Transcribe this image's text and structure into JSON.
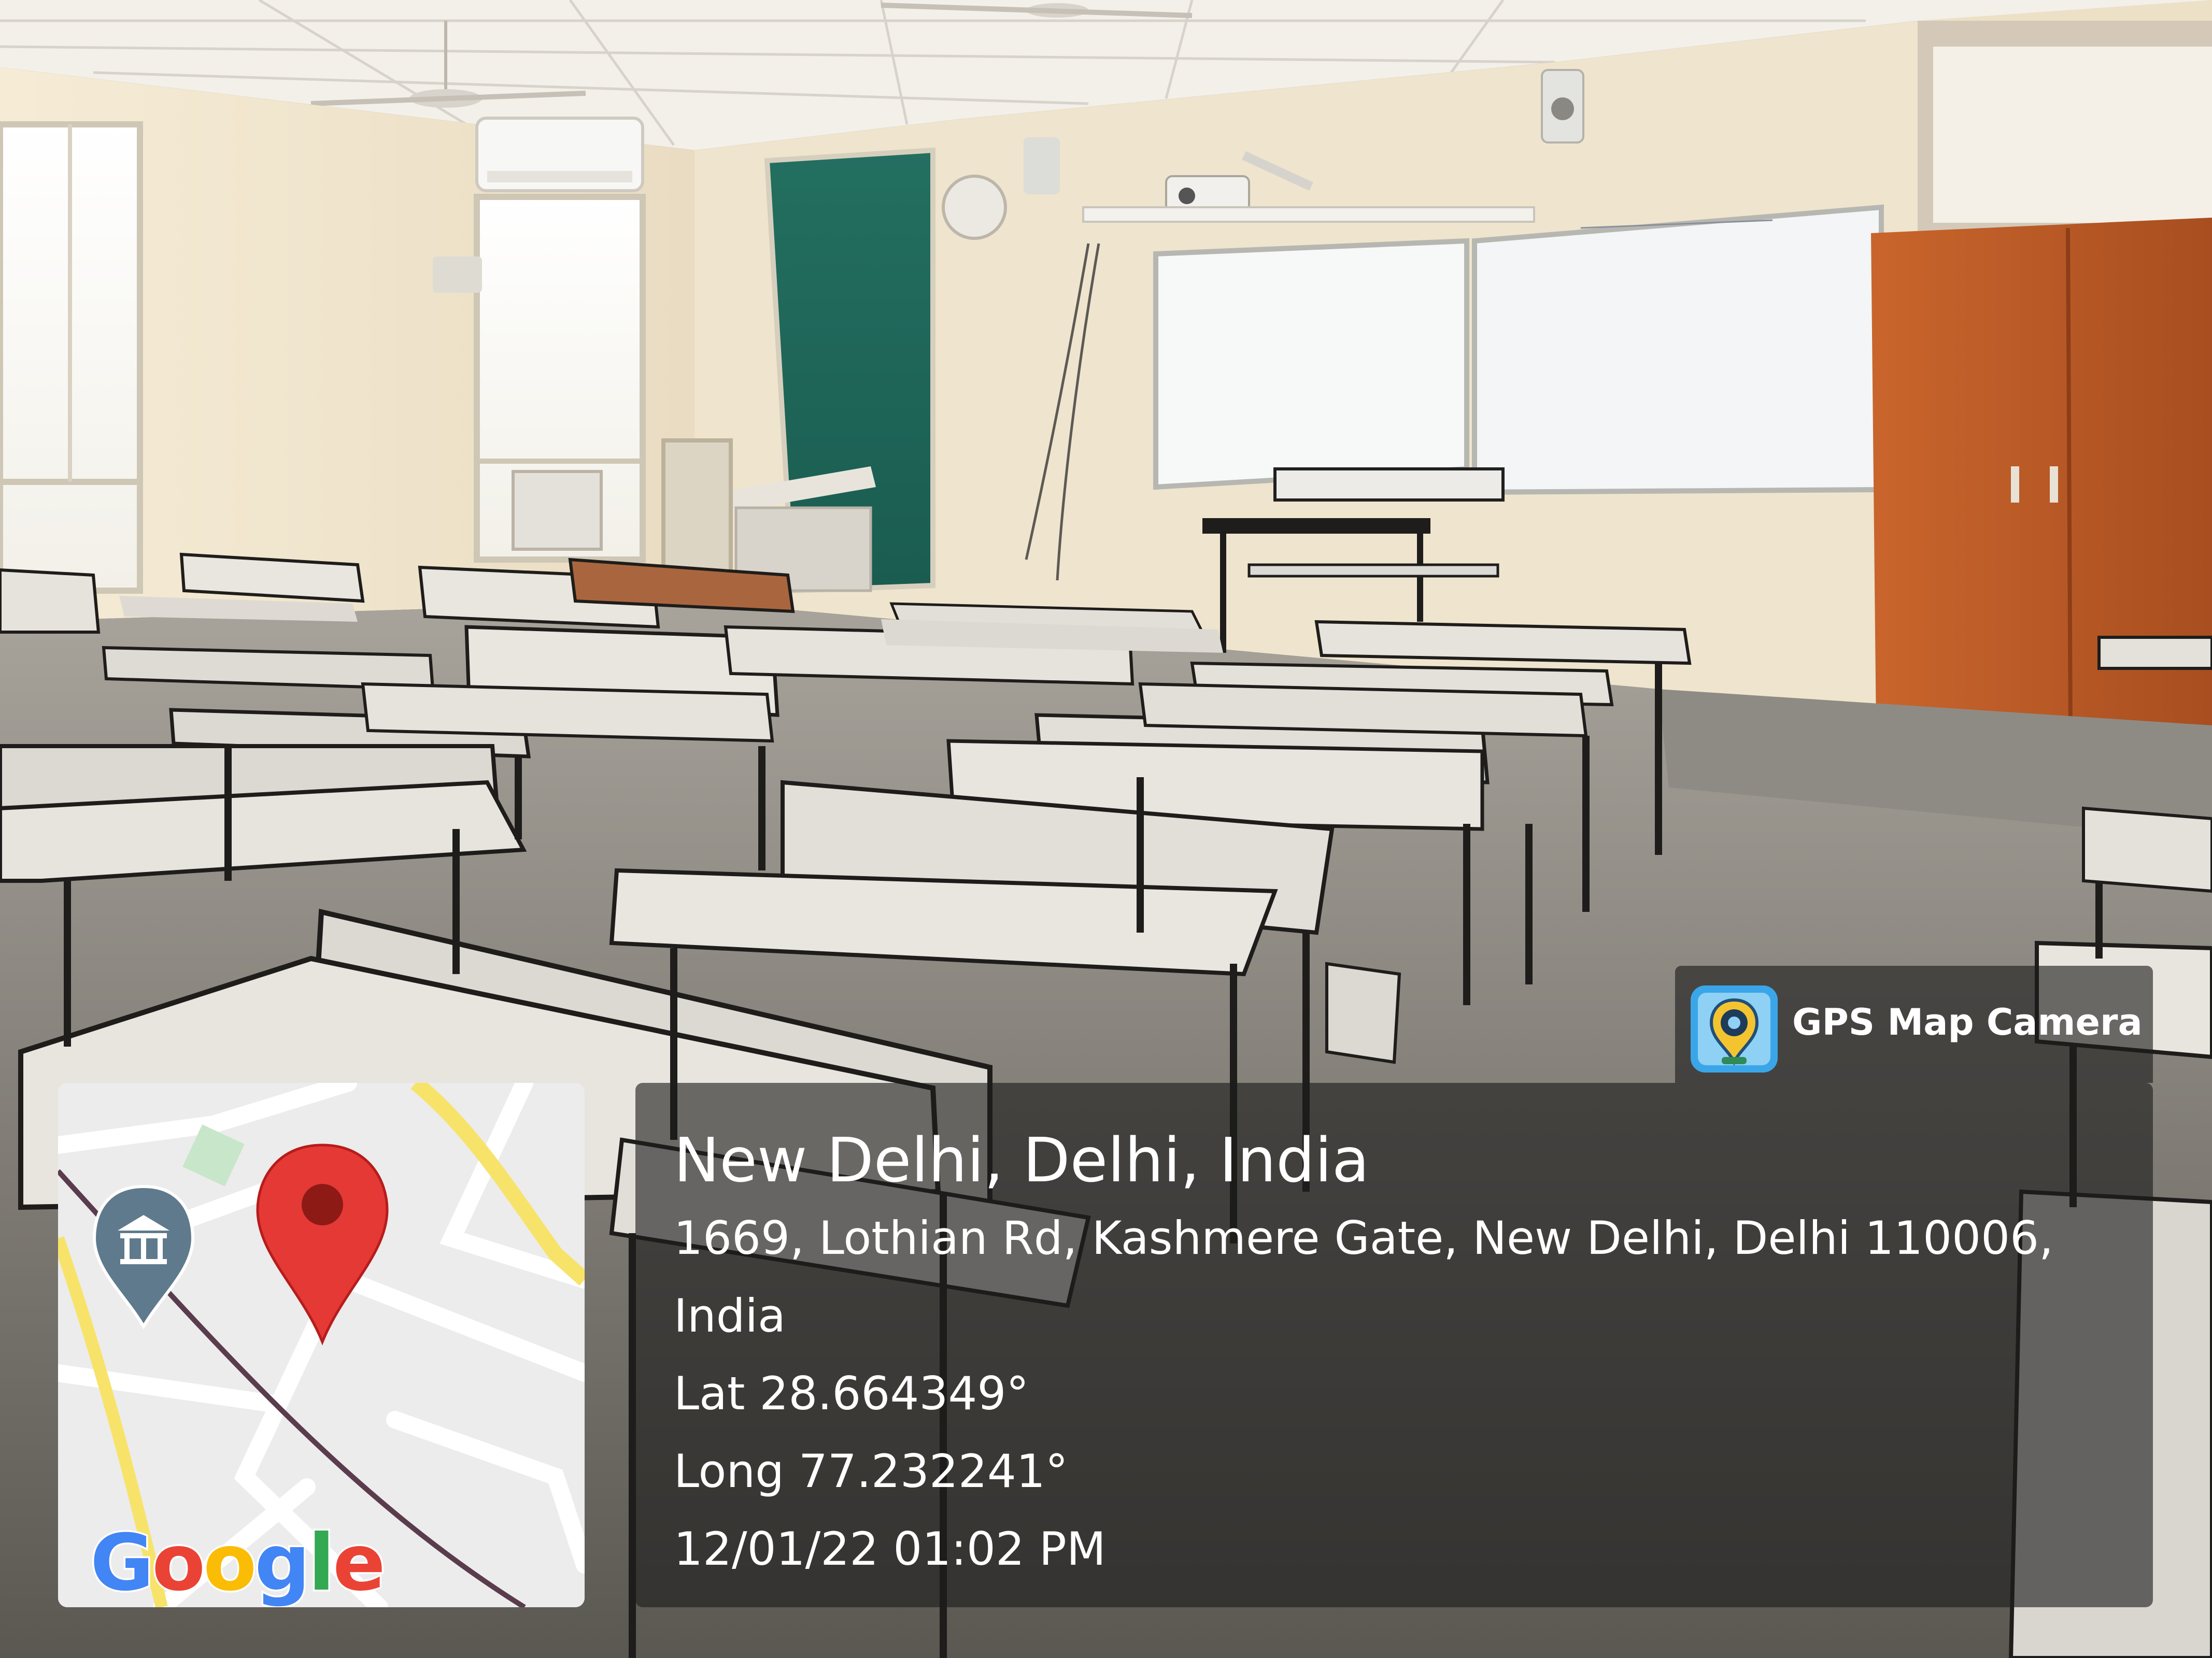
{
  "photo": {
    "subject": "classroom",
    "palette": {
      "wall": "#efe3cb",
      "ceiling": "#f4f1ea",
      "floor": "#807c75",
      "desk_top": "#dedad3",
      "desk_frame": "#1f1d1b",
      "chalkboard": "#1e6b5c",
      "whiteboard": "#f5f6f6",
      "door": "#b85a27"
    }
  },
  "overlay": {
    "app_name": "GPS Map Camera",
    "app_icon": "gps-map-camera-icon",
    "place_title": "New Delhi, Delhi, India",
    "address_line_1": "1669, Lothian Rd, Kashmere Gate, New Delhi, Delhi 110006,",
    "address_line_2": "India",
    "latitude": "Lat 28.664349°",
    "longitude": "Long 77.232241°",
    "datetime": "12/01/22 01:02 PM"
  },
  "map": {
    "logo_parts": [
      "G",
      "o",
      "o",
      "g",
      "l",
      "e"
    ],
    "logo_colors": [
      "#4285f4",
      "#ea4335",
      "#fbbc05",
      "#4285f4",
      "#34a853",
      "#ea4335"
    ],
    "marker_color": "#e53935",
    "poi_icon": "museum-icon",
    "poi_color": "#5f7a8c"
  }
}
